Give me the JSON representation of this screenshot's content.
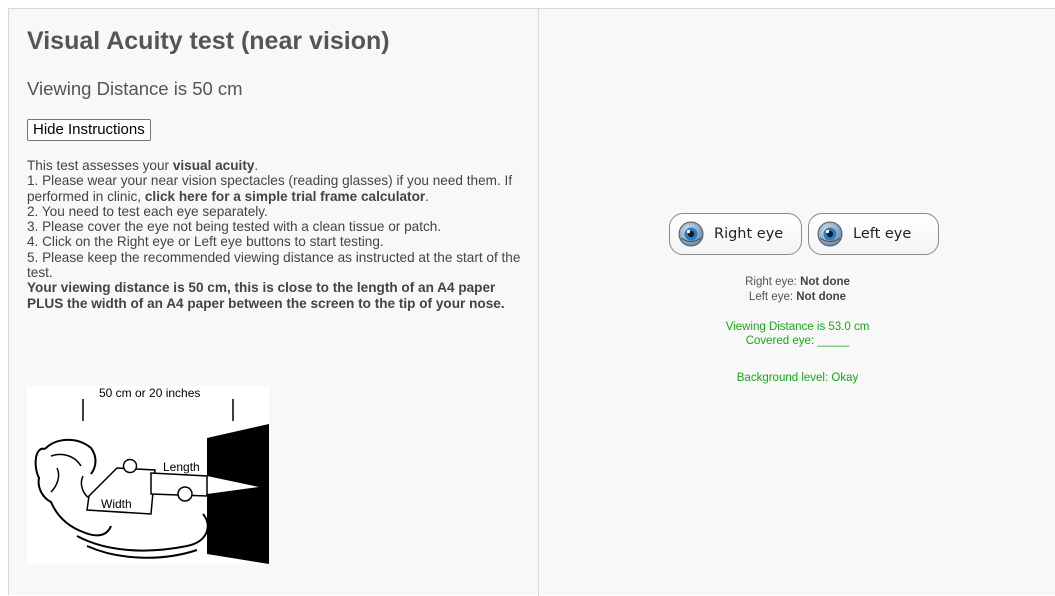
{
  "page": {
    "title": "Visual Acuity test (near vision)",
    "subtitle": "Viewing Distance is 50 cm",
    "hide_button_label": "Hide Instructions"
  },
  "instructions": {
    "intro_prefix": "This test assesses your ",
    "intro_bold": "visual acuity",
    "intro_suffix": ".",
    "step1_prefix": "1. Please wear your near vision spectacles (reading glasses) if you need them. If performed in clinic, ",
    "step1_link": "click here for a simple trial frame calculator",
    "step1_suffix": ".",
    "step2": "2. You need to test each eye separately.",
    "step3": "3. Please cover the eye not being tested with a clean tissue or patch.",
    "step4": "4. Click on the Right eye or Left eye buttons to start testing.",
    "step5": "5. Please keep the recommended viewing distance as instructed at the start of the test.",
    "distance_note": "Your viewing distance is 50 cm, this is close to the length of an A4 paper PLUS the width of an A4 paper between the screen to the tip of your nose."
  },
  "diagram": {
    "distance_label": "50 cm or 20 inches",
    "length_label": "Length",
    "width_label": "Width"
  },
  "eye_buttons": {
    "right_label": "Right eye",
    "left_label": "Left eye",
    "icon": "eye-icon"
  },
  "status": {
    "right_prefix": "Right eye: ",
    "right_value": "Not done",
    "left_prefix": "Left eye: ",
    "left_value": "Not done",
    "viewing_distance": "Viewing Distance is 53.0 cm",
    "covered_eye": "Covered eye: _____",
    "background_level": "Background level: Okay"
  },
  "colors": {
    "status_green": "#1aa51a",
    "text_gray": "#555555",
    "panel_background": "#f8f8f8"
  }
}
